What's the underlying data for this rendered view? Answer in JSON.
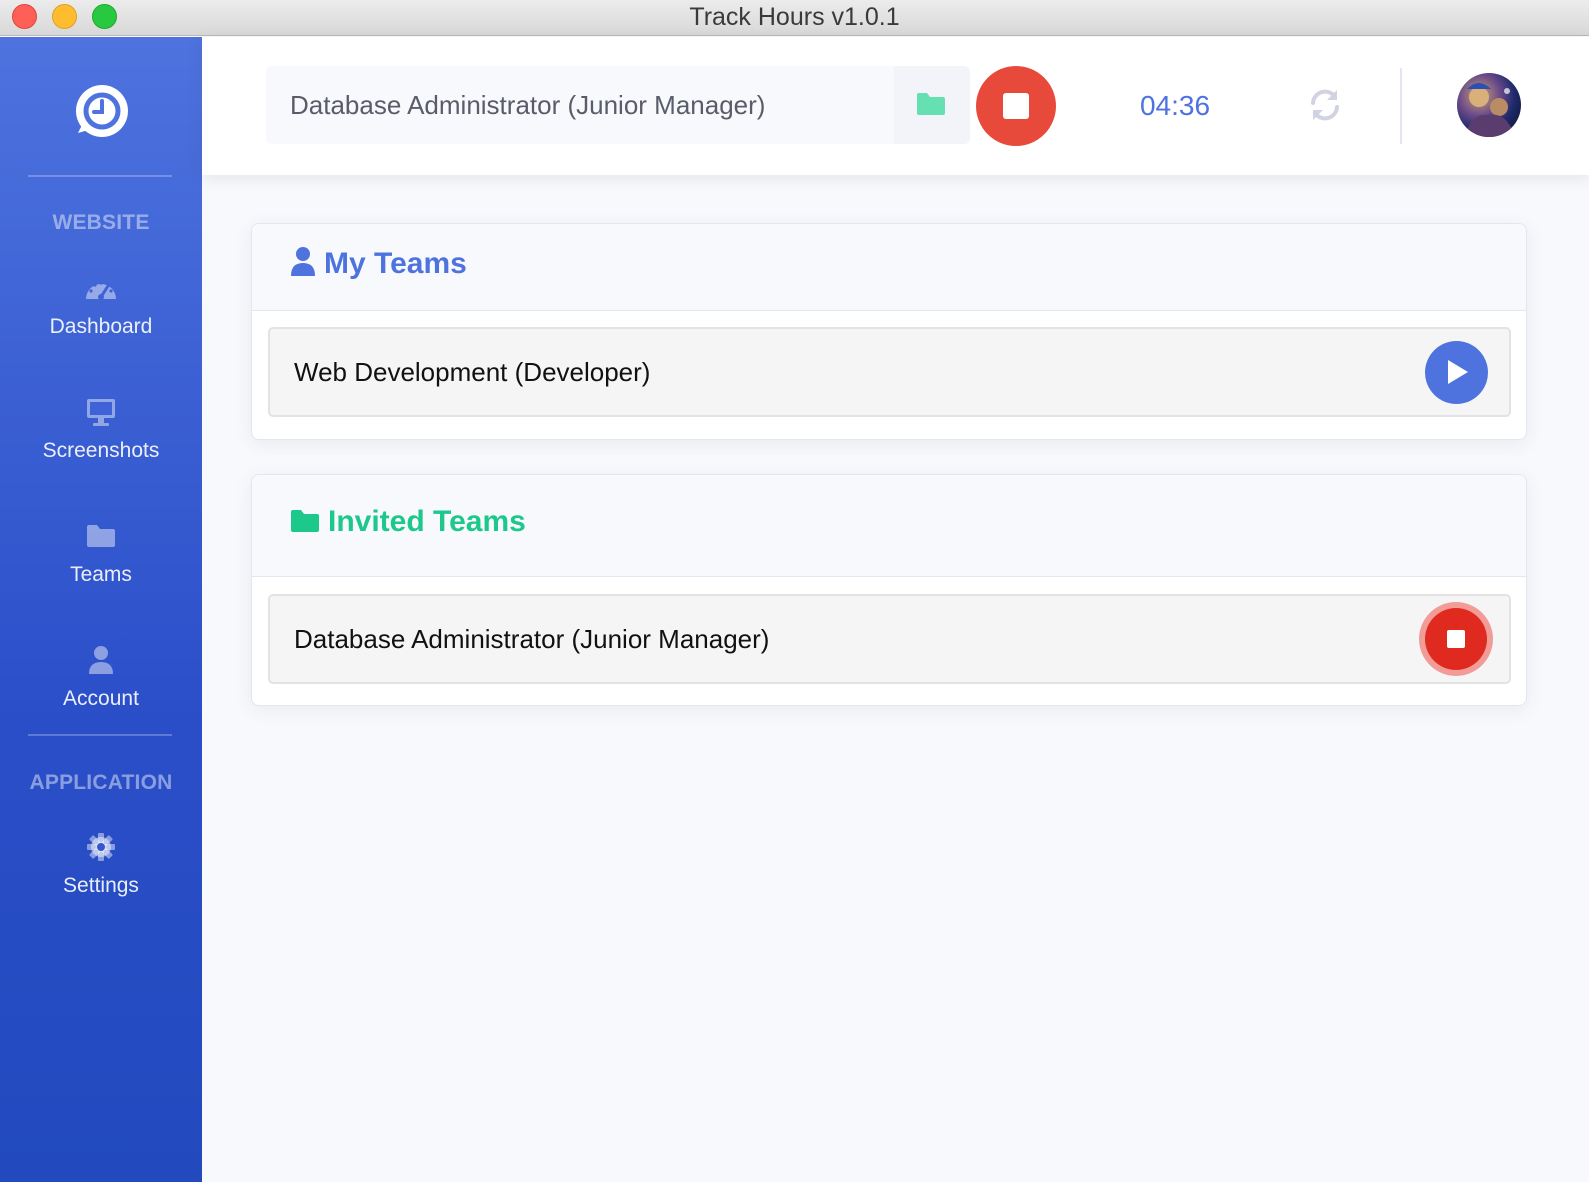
{
  "window": {
    "title": "Track Hours v1.0.1"
  },
  "sidebar": {
    "sections": [
      {
        "heading": "WEBSITE"
      },
      {
        "heading": "APPLICATION"
      }
    ],
    "items": [
      {
        "label": "Dashboard",
        "icon": "tachometer-icon"
      },
      {
        "label": "Screenshots",
        "icon": "desktop-icon"
      },
      {
        "label": "Teams",
        "icon": "folder-icon"
      },
      {
        "label": "Account",
        "icon": "user-icon"
      },
      {
        "label": "Settings",
        "icon": "gear-icon"
      }
    ]
  },
  "topbar": {
    "current_task": "Database Administrator (Junior Manager)",
    "timer": "04:36"
  },
  "my_teams": {
    "title": "My Teams",
    "rows": [
      {
        "label": "Web Development (Developer)",
        "action": "play"
      }
    ]
  },
  "invited_teams": {
    "title": "Invited Teams",
    "rows": [
      {
        "label": "Database Administrator (Junior Manager)",
        "action": "stop"
      }
    ]
  },
  "colors": {
    "primary": "#4e73df",
    "success": "#1cc88a",
    "danger": "#e74a3b"
  }
}
